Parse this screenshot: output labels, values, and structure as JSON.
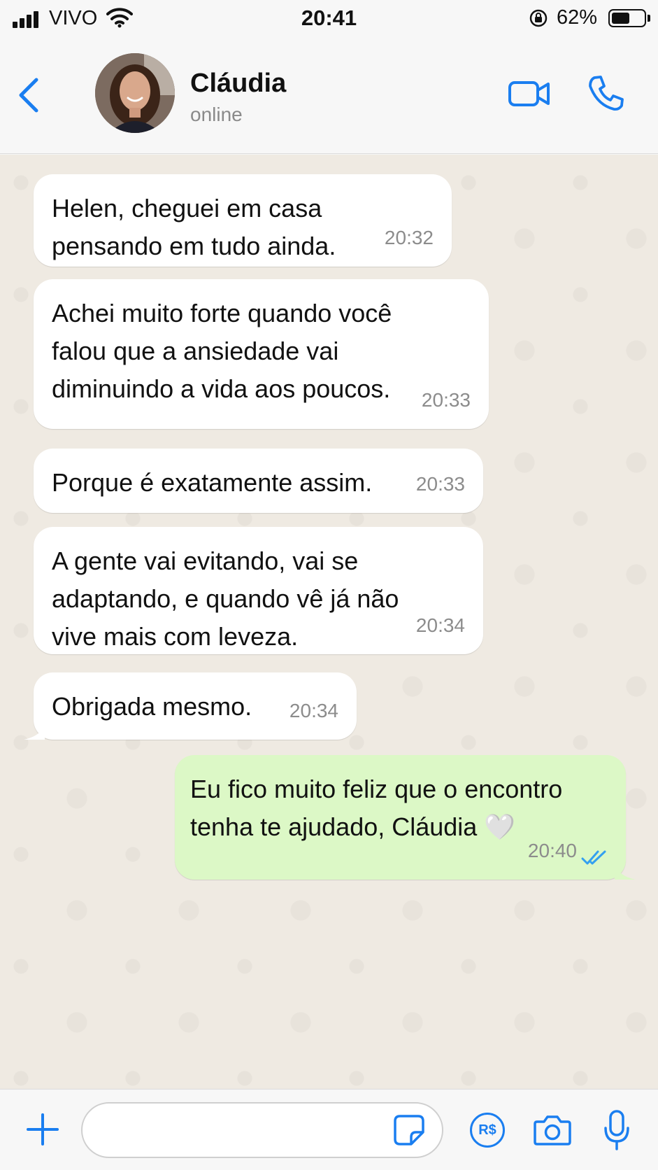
{
  "status_bar": {
    "carrier": "VIVO",
    "time": "20:41",
    "battery_percent": "62%",
    "battery_level": 0.62
  },
  "header": {
    "contact_name": "Cláudia",
    "contact_status": "online",
    "icons": [
      "back-icon",
      "avatar",
      "video-call-icon",
      "phone-call-icon"
    ]
  },
  "messages": [
    {
      "direction": "incoming",
      "text": "Helen, cheguei em casa\npensando em tudo ainda.",
      "time": "20:32"
    },
    {
      "direction": "incoming",
      "text": "Achei muito forte quando você\nfalou que a ansiedade vai\ndiminuindo a vida aos poucos.",
      "time": "20:33"
    },
    {
      "direction": "incoming",
      "text": "Porque é exatamente assim.",
      "time": "20:33"
    },
    {
      "direction": "incoming",
      "text": "A gente vai evitando, vai se\nadaptando, e quando vê já não\nvive mais com leveza.",
      "time": "20:34"
    },
    {
      "direction": "incoming",
      "text": "Obrigada mesmo.",
      "time": "20:34"
    },
    {
      "direction": "outgoing",
      "text": "Eu fico muito feliz que o encontro\ntenha te ajudado, Cláudia 🤍",
      "time": "20:40",
      "read": true
    }
  ],
  "input_bar": {
    "placeholder": "",
    "icons": [
      "plus-icon",
      "sticker-icon",
      "payment-icon",
      "camera-icon",
      "microphone-icon"
    ],
    "pay_label": "R$"
  },
  "colors": {
    "accent": "#1a7ef0",
    "incoming_bubble": "#ffffff",
    "outgoing_bubble": "#dcf8c6",
    "chat_background": "#efeae2",
    "read_ticks": "#34a0f0"
  }
}
